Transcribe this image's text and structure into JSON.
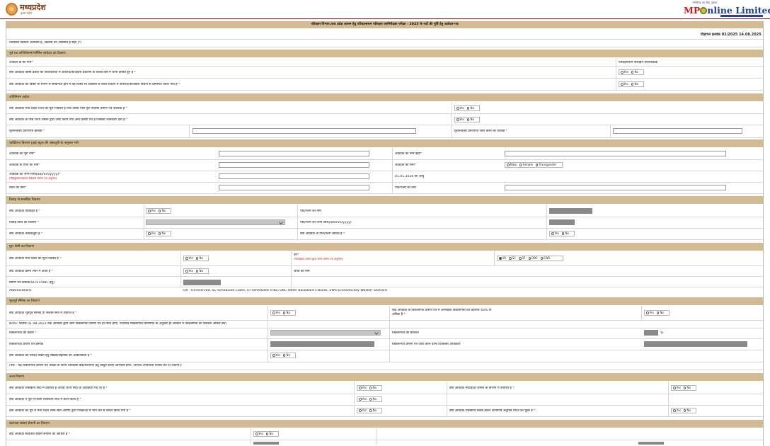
{
  "header": {
    "state_name": "मध्यप्रदेश",
    "state_tagline": "हृदय प्रदेश",
    "partner_tagline": "भरोसेमंद का सेवा प्रदाता",
    "brand_mp": "MP",
    "brand_rest": "nline Limited"
  },
  "form": {
    "title": "परिवहन विभाग,मध्य प्रदेश शासन हेतु परिवहनाराम परिवहन उपनिरीक्षक परीक्षा - 2025 के पदों की पूर्ति हेतु आवेदन-पत्र",
    "advt_no": "विज्ञापन क्रमांक 02/2025 14.08.2025",
    "note_required": "तारांकित विकल्प अनिवार्य है, अवशेष उन अनिवार्य है सही (*)"
  },
  "sections": {
    "prev_app": {
      "title": "पूर्व रज अप्लिकेशन/फॉर्मिल आवेदन का विवरण",
      "label_app_no": "आवेदन क्र का नाम",
      "label_app_no_right": "परिवहनाराम परिवहन उपनिरीक्षक",
      "q1": "क्या आवेदक किसी प्रकार का विधिविरोधा में अपराध/फ़ौजदारी प्रकरणो के किसी दोष में कभी दोषित हुए है",
      "q2": "क्या आवेदक को किसी भी निगम से सम्बन्धित होने में वह किसी भी व्यवस्था से लेकर विधान में अपराध/फ़ौजदारी विधान से प्रमाणित किया गया है"
    },
    "domicile": {
      "title": "अधिनियम अर्हता",
      "q1": "क्या आवेदक मध्य प्रदेश राज्य का मूल निवासी है तथा उसके पास मूल निवासी प्रमाण पत्र उपलब्ध है",
      "q2": "क्या आवेदक के पास राज्य शासन द्वारा जारी किया गया अन्य प्रमाण पत्र है जिसकी जानकारी देना है",
      "label_cert_no": "मूलनिवासी प्रमाणपत्र क्रमांक",
      "label_cert_date": "मूलनिवासी प्रमाणपत्र जारी करने की तारीख"
    },
    "personal": {
      "title": "व्यक्तिगत विवरण (हाई स्कूल की अंकसूची के अनुसार भरें)",
      "label_name": "आवेदक का पूरा नाम",
      "label_name_hindi": "आवेदक का नाम हिंदी",
      "label_father": "आवेदक के पिता का नाम",
      "label_gender": "आवेदक का लिंग",
      "label_dob": "आवेदक की जन्म तिथि(dd/mm/yyyy)",
      "dob_hint": "(मैट्रिकुलेशन/हायर सेकेंडरी प्रमाण पत्र अनुसार)",
      "label_age_ref": "01.01.2026 को आयु",
      "label_mother": "माता का नाम",
      "label_spouse": "पति/पत्नी का नाम"
    },
    "marital": {
      "title": "विवाह से सम्बंधित विवरण",
      "q_married": "क्या आवेदक विवाहित है",
      "label_spouse_name": "पति/पत्नी का नाम",
      "label_marriage_date": "विवाह तिथि का विवरण",
      "label_spouse_dob": "पति/पत्नी की जन्म तिथि(dd/mm/yyyy)",
      "q_divorce": "क्या आवेदक तलाकशुदा है",
      "q_spouse_alive": "क्या आवेदक के पति/पत्नी जीवित है"
    },
    "category": {
      "title": "मूल श्रेणी का विवरण",
      "q_mp_caste": "क्या आवेदक मध्य प्रदेश का मूल निवासी है",
      "label_cat": "वर्ग",
      "cat_hint": "(मध्यप्रदेश शासन द्वारा जारी प्रमाण पत्र अनुसार)",
      "q_creamy": "क्या आवेदक क्रीमी लेयर में आता है",
      "label_caste": "जाति का नाम",
      "label_cert": "प्रमाण पत्र क्रमांक(SC/ST/OBC हेतु)",
      "abbrev_label": "Abbreviations",
      "abbrev_text": "UR - Unreserved, SC-Scheduled Caste, ST-Scheduled Tribe, OBC-Other Backward Classes, EWS-Economically Weaker Sections"
    },
    "ex_service": {
      "title": "भूतपूर्व सैनिक का विवरण",
      "q_ex": "क्या आवेदक भूतपूर्व सैनिक या सशस्त्र सेना में सेवारत है",
      "q_ex_right": "क्या आवेदक के विकलांगता प्रमाण पत्र में उल्लेखित विकलांगता का प्रतिशत 40% या अधिक है",
      "note_long": "Note: दिनांक 01.08.2023 तक आवेदक द्वारा जारी विकलांगता प्रमाण पत्र ही मान्य होगा, निर्धारित विकलांगता प्रमाणपत्र के अनुसार ही आवेदन में विकलांगता का प्रतिशत अंकित करें।",
      "label_type": "विकलांगता का प्रकार",
      "label_percent": "विकलांगता का प्रतिशत",
      "percent_sign": "%",
      "label_cert_no": "विकलांगता प्रमाण पत्र क्रमांक",
      "label_issuer": "विकलांगता प्रमाण पत्र जारी करने वाला चिकित्सा अधिकारी",
      "q_scribe": "क्या आवेदक को परीक्षा लेखन हेतु लेखक/सहायक की आवश्यकता है",
      "note_small": "(नोट - यह विकलांगता प्रमाण पत्र परीक्षा के समय चिकित्सा बोर्ड/सत्यापन हेतु प्रस्तुत करना अनिवार्य होगा, अन्यथा अभ्यर्थिता निरस्त कर दी जावेगी।)"
    },
    "other": {
      "title": "अन्य विवरण",
      "q1": "क्या आवेदक शासकीय सेवा में कार्यरत है अथवा राज्य सेवा के अधिकारी पद पर है",
      "q1_right": "क्या आवेदक मध्यप्रदेश शासन के विभाग में कार्यरत है",
      "q2": "क्या आवेदक ने पूर्व में किसी शासकीय सेवा में कार्य किया है",
      "q3": "क्या आवेदक को पूर्व में मध्य प्रदेश लोक सेवा आयोग द्वारा परीक्षाओं में भाग लेने से वंचित किया गया है",
      "q3_right": "क्या आवेदक शासकीय सेवक होकर विभागीय अनुमति प्राप्त कर चुका है"
    },
    "freedom": {
      "title": "स्वतंत्रता संग्राम सेनानी का विवरण",
      "q1": "क्या आवेदक स्वतंत्रता संग्राम सेनानी का आश्रित है"
    }
  },
  "options": {
    "yes": "Yes",
    "no": "No",
    "male": "Male",
    "female": "Female",
    "trans": "Transgender",
    "cats": [
      "UR",
      "SC",
      "ST",
      "OBC",
      "EWS"
    ]
  }
}
